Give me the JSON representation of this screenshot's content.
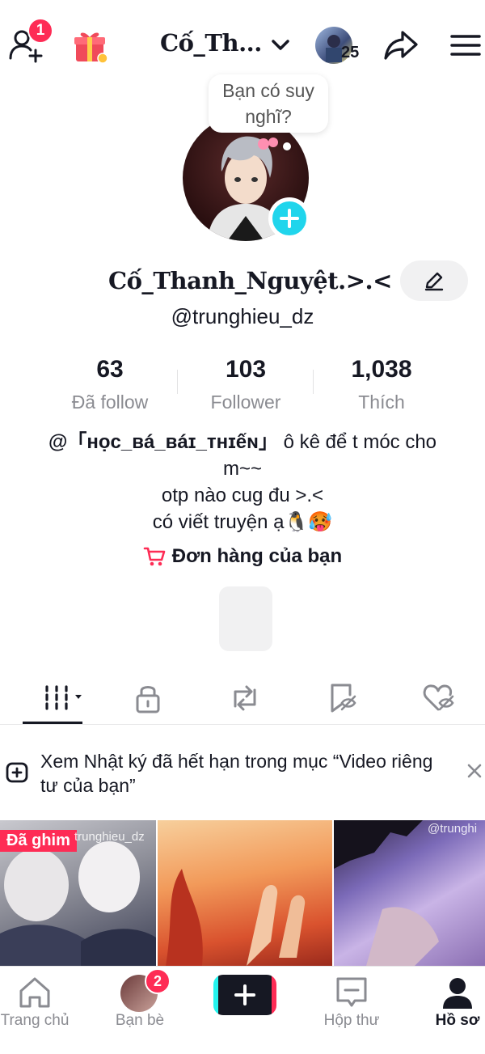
{
  "header": {
    "add_friend_badge": "1",
    "username": "Cố_Th...",
    "story_count": "25"
  },
  "profile": {
    "bubble_text": "Bạn có suy nghĩ?",
    "display_name": "Cố_Thanh_Nguyệt.>.<",
    "handle": "@trunghieu_dz"
  },
  "stats": [
    {
      "value": "63",
      "label": "Đã follow"
    },
    {
      "value": "103",
      "label": "Follower"
    },
    {
      "value": "1,038",
      "label": "Thích"
    }
  ],
  "bio": {
    "mention": "@「ʜọᴄ_ʙá_ʙáɪ_ᴛʜɪếɴ」",
    "line1_rest": " ô kê để t móc cho m~~",
    "line2": "otp nào cug đu >.<",
    "line3": "có viết truyện ạ🐧🥵"
  },
  "orders_label": "Đơn hàng của bạn",
  "notice_text": "Xem Nhật ký đã hết hạn trong mục “Video riêng tư của bạn”",
  "grid": {
    "pinned_label": "Đã ghim",
    "watermark": "trunghieu_dz",
    "watermark3": "@trunghi"
  },
  "nav": {
    "home": "Trang chủ",
    "friends": "Bạn bè",
    "friends_badge": "2",
    "inbox": "Hộp thư",
    "profile": "Hồ sơ"
  },
  "colors": {
    "accent": "#fe2c55",
    "cyan": "#20d5ec",
    "text": "#161823",
    "muted": "#8a8b91"
  }
}
